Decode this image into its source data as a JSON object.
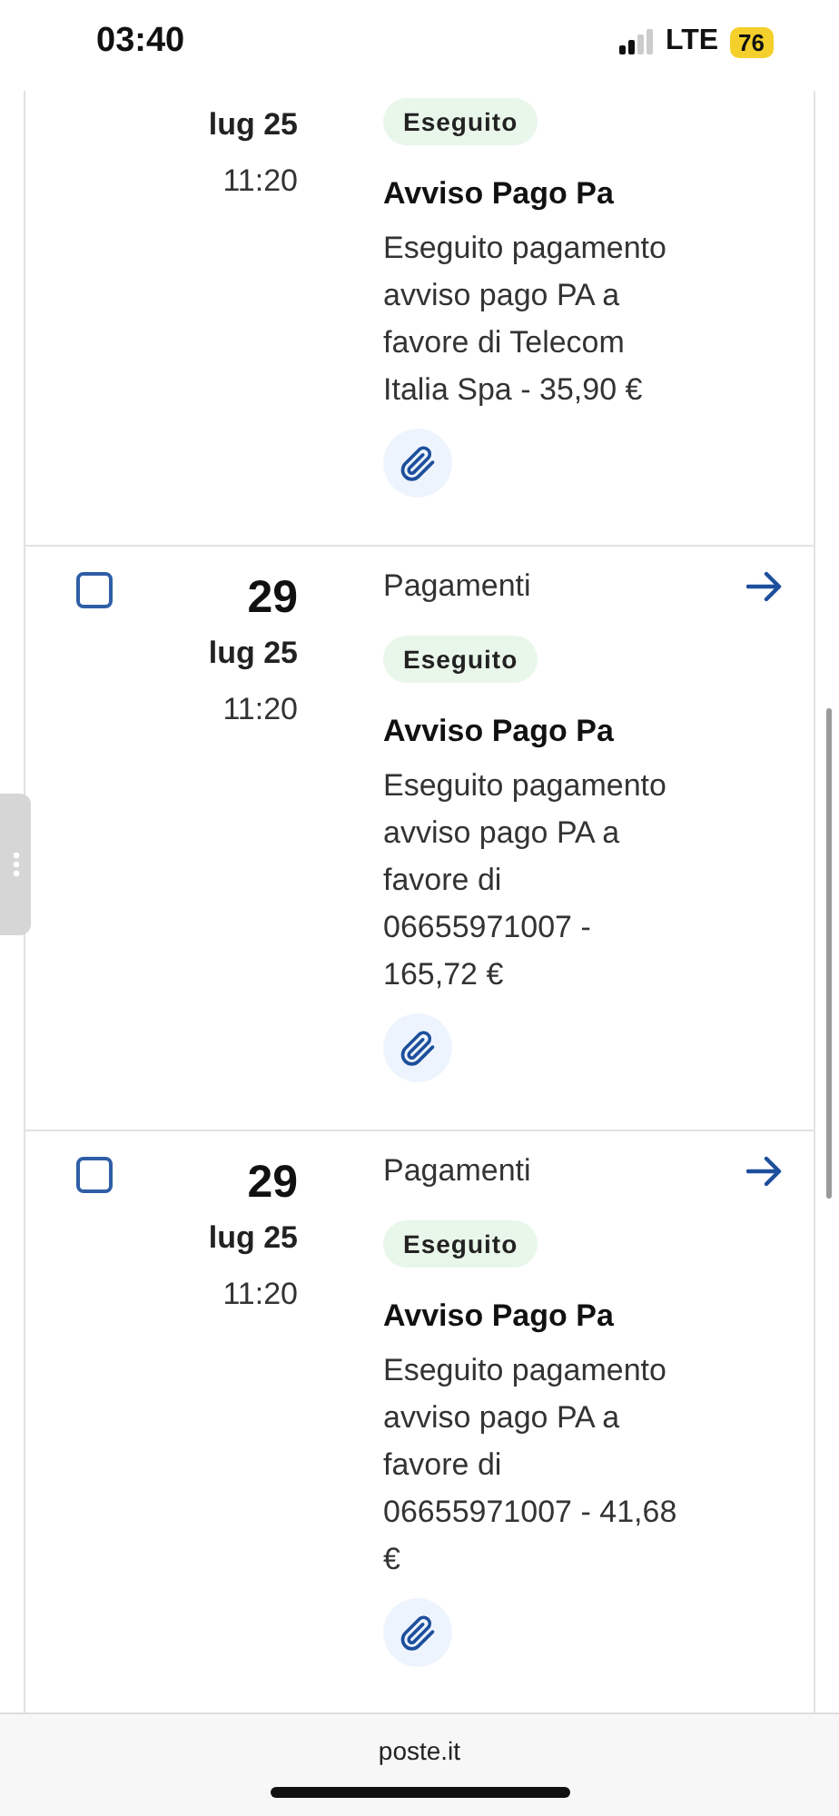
{
  "status_bar": {
    "time": "03:40",
    "network": "LTE",
    "battery": "76"
  },
  "rows": [
    {
      "month": "lug 25",
      "time": "11:20",
      "status": "Eseguito",
      "title": "Avviso Pago Pa",
      "description": "Eseguito pagamento avviso pago PA a favore di Telecom Italia Spa - 35,90 €"
    },
    {
      "checked": false,
      "day": "29",
      "month": "lug 25",
      "time": "11:20",
      "category": "Pagamenti",
      "status": "Eseguito",
      "title": "Avviso Pago Pa",
      "description": "Eseguito pagamento avviso pago PA a favore di 06655971007 - 165,72 €"
    },
    {
      "checked": false,
      "day": "29",
      "month": "lug 25",
      "time": "11:20",
      "category": "Pagamenti",
      "status": "Eseguito",
      "title": "Avviso Pago Pa",
      "description": "Eseguito pagamento avviso pago PA a favore di 06655971007 - 41,68 €"
    }
  ],
  "browser_bar": {
    "url": "poste.it"
  }
}
